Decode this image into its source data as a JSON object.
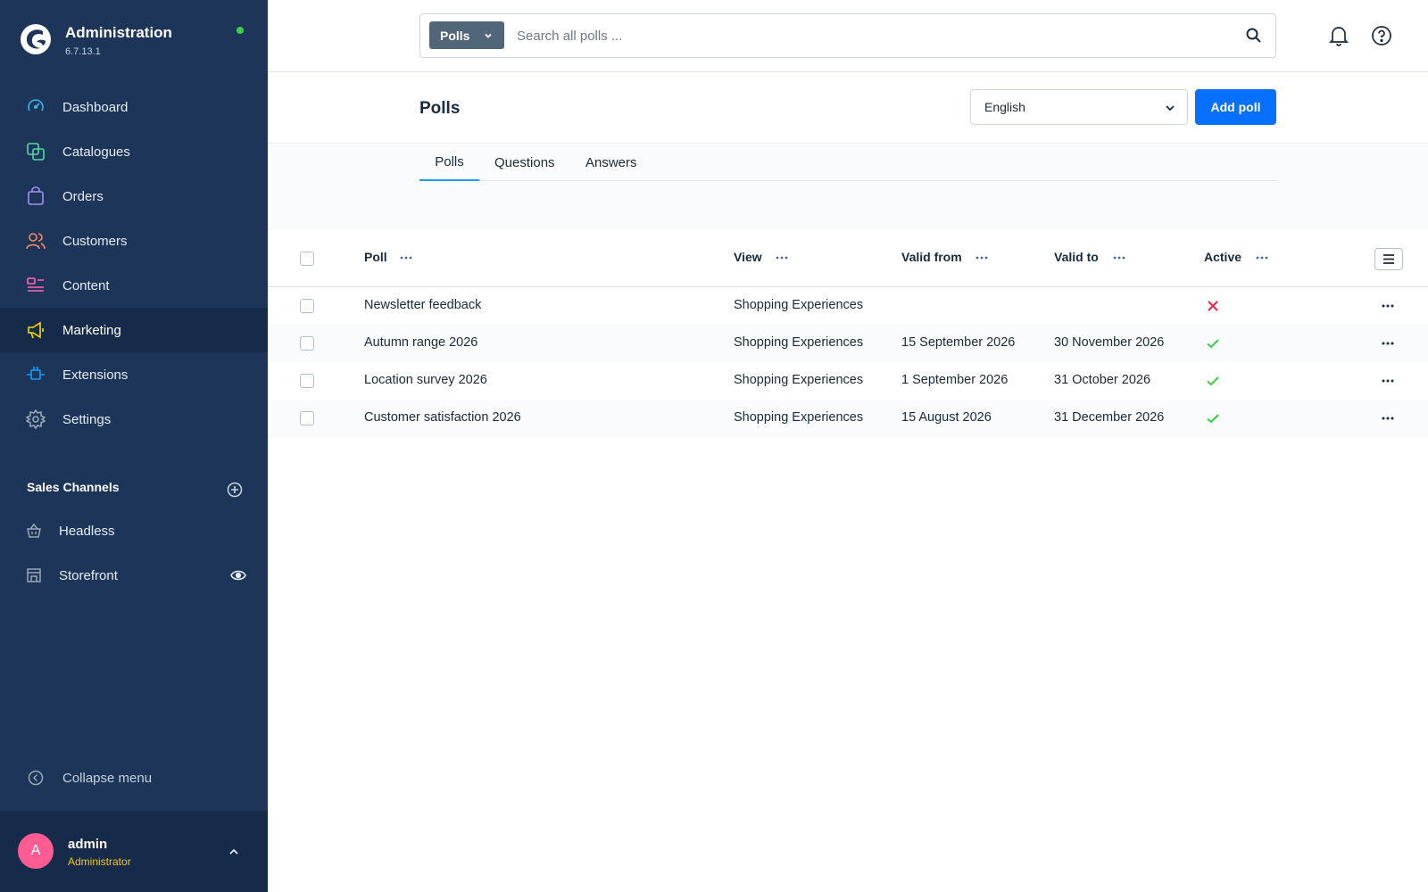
{
  "app": {
    "title": "Administration",
    "version": "6.7.13.1"
  },
  "sidebar": {
    "items": [
      {
        "label": "Dashboard",
        "icon": "dashboard-icon"
      },
      {
        "label": "Catalogues",
        "icon": "catalogues-icon"
      },
      {
        "label": "Orders",
        "icon": "orders-icon"
      },
      {
        "label": "Customers",
        "icon": "customers-icon"
      },
      {
        "label": "Content",
        "icon": "content-icon"
      },
      {
        "label": "Marketing",
        "icon": "marketing-icon",
        "active": true
      },
      {
        "label": "Extensions",
        "icon": "extensions-icon"
      },
      {
        "label": "Settings",
        "icon": "settings-icon"
      }
    ],
    "sales_channels_title": "Sales Channels",
    "sales_channels": [
      {
        "label": "Headless",
        "icon": "basket-icon"
      },
      {
        "label": "Storefront",
        "icon": "storefront-icon"
      }
    ],
    "collapse_label": "Collapse menu"
  },
  "user": {
    "initial": "A",
    "name": "admin",
    "role": "Administrator"
  },
  "search": {
    "type_label": "Polls",
    "placeholder": "Search all polls ..."
  },
  "page": {
    "title": "Polls",
    "language": "English",
    "add_button": "Add poll"
  },
  "tabs": [
    {
      "label": "Polls",
      "active": true
    },
    {
      "label": "Questions"
    },
    {
      "label": "Answers"
    }
  ],
  "table": {
    "columns": [
      "Poll",
      "View",
      "Valid from",
      "Valid to",
      "Active"
    ],
    "rows": [
      {
        "poll": "Newsletter feedback",
        "view": "Shopping Experiences",
        "valid_from": "",
        "valid_to": "",
        "active": false
      },
      {
        "poll": "Autumn range 2026",
        "view": "Shopping Experiences",
        "valid_from": "15 September 2026",
        "valid_to": "30 November 2026",
        "active": true
      },
      {
        "poll": "Location survey 2026",
        "view": "Shopping Experiences",
        "valid_from": "1 September 2026",
        "valid_to": "31 October 2026",
        "active": true
      },
      {
        "poll": "Customer satisfaction 2026",
        "view": "Shopping Experiences",
        "valid_from": "15 August 2026",
        "valid_to": "31 December 2026",
        "active": true
      }
    ]
  },
  "colors": {
    "sidebar_bg": "#1c3558",
    "primary": "#0870ff",
    "tab_active": "#189eff",
    "online": "#37d046",
    "success": "#37d046",
    "error": "#de294c",
    "avatar": "#ff5c93",
    "role": "#ffc60a"
  }
}
